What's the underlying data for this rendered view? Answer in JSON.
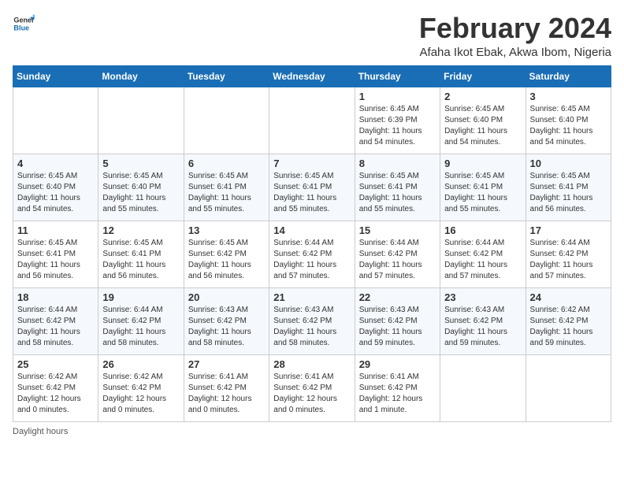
{
  "header": {
    "logo_general": "General",
    "logo_blue": "Blue",
    "main_title": "February 2024",
    "subtitle": "Afaha Ikot Ebak, Akwa Ibom, Nigeria"
  },
  "days_of_week": [
    "Sunday",
    "Monday",
    "Tuesday",
    "Wednesday",
    "Thursday",
    "Friday",
    "Saturday"
  ],
  "weeks": [
    [
      {
        "day": "",
        "info": ""
      },
      {
        "day": "",
        "info": ""
      },
      {
        "day": "",
        "info": ""
      },
      {
        "day": "",
        "info": ""
      },
      {
        "day": "1",
        "info": "Sunrise: 6:45 AM\nSunset: 6:39 PM\nDaylight: 11 hours and 54 minutes."
      },
      {
        "day": "2",
        "info": "Sunrise: 6:45 AM\nSunset: 6:40 PM\nDaylight: 11 hours and 54 minutes."
      },
      {
        "day": "3",
        "info": "Sunrise: 6:45 AM\nSunset: 6:40 PM\nDaylight: 11 hours and 54 minutes."
      }
    ],
    [
      {
        "day": "4",
        "info": "Sunrise: 6:45 AM\nSunset: 6:40 PM\nDaylight: 11 hours and 54 minutes."
      },
      {
        "day": "5",
        "info": "Sunrise: 6:45 AM\nSunset: 6:40 PM\nDaylight: 11 hours and 55 minutes."
      },
      {
        "day": "6",
        "info": "Sunrise: 6:45 AM\nSunset: 6:41 PM\nDaylight: 11 hours and 55 minutes."
      },
      {
        "day": "7",
        "info": "Sunrise: 6:45 AM\nSunset: 6:41 PM\nDaylight: 11 hours and 55 minutes."
      },
      {
        "day": "8",
        "info": "Sunrise: 6:45 AM\nSunset: 6:41 PM\nDaylight: 11 hours and 55 minutes."
      },
      {
        "day": "9",
        "info": "Sunrise: 6:45 AM\nSunset: 6:41 PM\nDaylight: 11 hours and 55 minutes."
      },
      {
        "day": "10",
        "info": "Sunrise: 6:45 AM\nSunset: 6:41 PM\nDaylight: 11 hours and 56 minutes."
      }
    ],
    [
      {
        "day": "11",
        "info": "Sunrise: 6:45 AM\nSunset: 6:41 PM\nDaylight: 11 hours and 56 minutes."
      },
      {
        "day": "12",
        "info": "Sunrise: 6:45 AM\nSunset: 6:41 PM\nDaylight: 11 hours and 56 minutes."
      },
      {
        "day": "13",
        "info": "Sunrise: 6:45 AM\nSunset: 6:42 PM\nDaylight: 11 hours and 56 minutes."
      },
      {
        "day": "14",
        "info": "Sunrise: 6:44 AM\nSunset: 6:42 PM\nDaylight: 11 hours and 57 minutes."
      },
      {
        "day": "15",
        "info": "Sunrise: 6:44 AM\nSunset: 6:42 PM\nDaylight: 11 hours and 57 minutes."
      },
      {
        "day": "16",
        "info": "Sunrise: 6:44 AM\nSunset: 6:42 PM\nDaylight: 11 hours and 57 minutes."
      },
      {
        "day": "17",
        "info": "Sunrise: 6:44 AM\nSunset: 6:42 PM\nDaylight: 11 hours and 57 minutes."
      }
    ],
    [
      {
        "day": "18",
        "info": "Sunrise: 6:44 AM\nSunset: 6:42 PM\nDaylight: 11 hours and 58 minutes."
      },
      {
        "day": "19",
        "info": "Sunrise: 6:44 AM\nSunset: 6:42 PM\nDaylight: 11 hours and 58 minutes."
      },
      {
        "day": "20",
        "info": "Sunrise: 6:43 AM\nSunset: 6:42 PM\nDaylight: 11 hours and 58 minutes."
      },
      {
        "day": "21",
        "info": "Sunrise: 6:43 AM\nSunset: 6:42 PM\nDaylight: 11 hours and 58 minutes."
      },
      {
        "day": "22",
        "info": "Sunrise: 6:43 AM\nSunset: 6:42 PM\nDaylight: 11 hours and 59 minutes."
      },
      {
        "day": "23",
        "info": "Sunrise: 6:43 AM\nSunset: 6:42 PM\nDaylight: 11 hours and 59 minutes."
      },
      {
        "day": "24",
        "info": "Sunrise: 6:42 AM\nSunset: 6:42 PM\nDaylight: 11 hours and 59 minutes."
      }
    ],
    [
      {
        "day": "25",
        "info": "Sunrise: 6:42 AM\nSunset: 6:42 PM\nDaylight: 12 hours and 0 minutes."
      },
      {
        "day": "26",
        "info": "Sunrise: 6:42 AM\nSunset: 6:42 PM\nDaylight: 12 hours and 0 minutes."
      },
      {
        "day": "27",
        "info": "Sunrise: 6:41 AM\nSunset: 6:42 PM\nDaylight: 12 hours and 0 minutes."
      },
      {
        "day": "28",
        "info": "Sunrise: 6:41 AM\nSunset: 6:42 PM\nDaylight: 12 hours and 0 minutes."
      },
      {
        "day": "29",
        "info": "Sunrise: 6:41 AM\nSunset: 6:42 PM\nDaylight: 12 hours and 1 minute."
      },
      {
        "day": "",
        "info": ""
      },
      {
        "day": "",
        "info": ""
      }
    ]
  ],
  "footer": {
    "daylight_label": "Daylight hours"
  }
}
